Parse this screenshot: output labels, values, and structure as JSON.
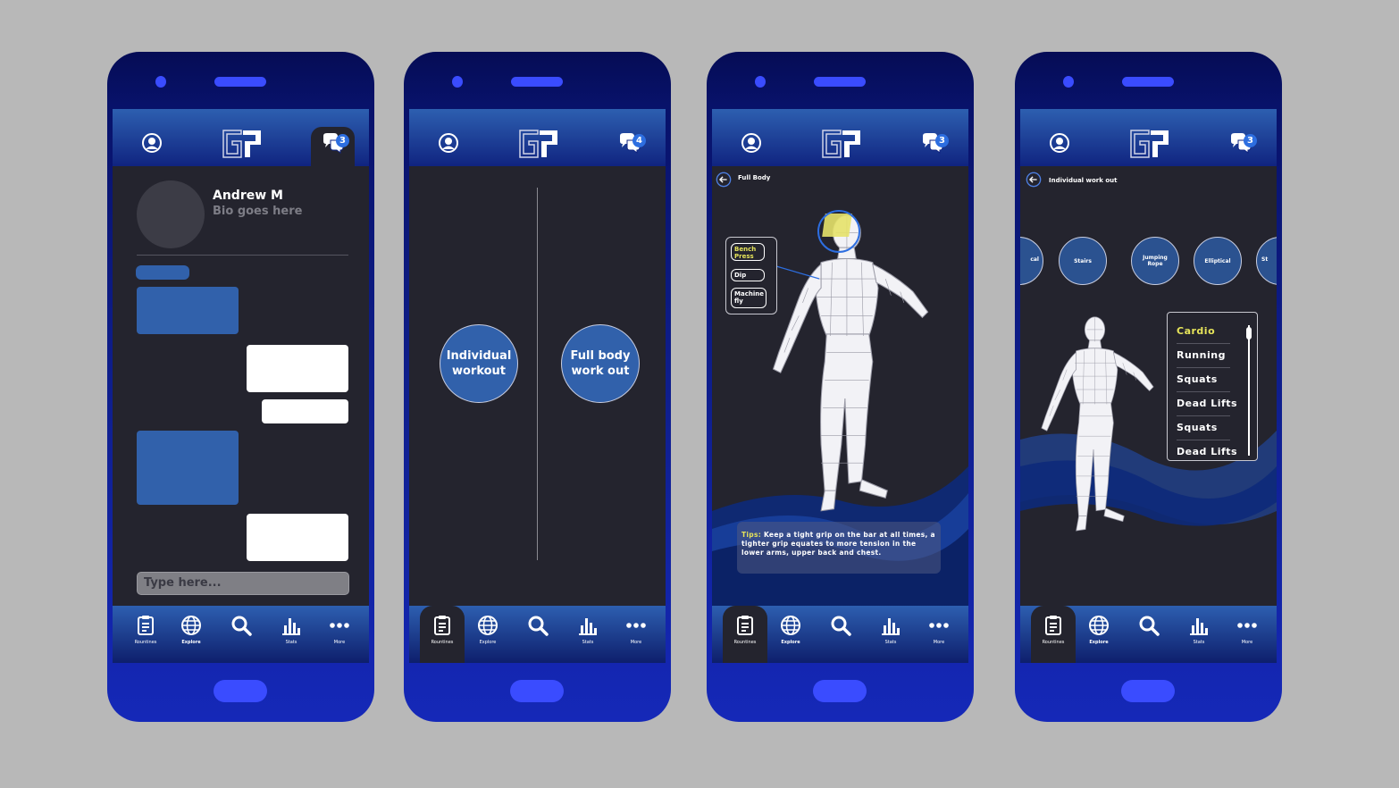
{
  "nav": {
    "routines": "Rountines",
    "explore": "Explore",
    "stats": "Stats",
    "more": "More"
  },
  "phone1": {
    "badge": "3",
    "name": "Andrew M",
    "bio": "Bio goes here",
    "input_placeholder": "Type here..."
  },
  "phone2": {
    "badge": "4",
    "option_individual": "Individual workout",
    "option_fullbody": "Full body work out"
  },
  "phone3": {
    "badge": "3",
    "back_label": "Full Body",
    "exercises": [
      "Bench Press",
      "Dip",
      "Machine fly"
    ],
    "tips_label": "Tips:",
    "tips_text": "Keep a tight grip on the bar at all times, a tighter grip equates to more tension in the lower arms, upper back and chest."
  },
  "phone4": {
    "badge": "3",
    "back_label": "Individual work out",
    "circles": [
      "cal",
      "Stairs",
      "Jumping Rope",
      "Elliptical",
      "St"
    ],
    "menu": [
      "Cardio",
      "Running",
      "Squats",
      "Dead Lifts",
      "Squats",
      "Dead Lifts"
    ]
  },
  "colors": {
    "accent": "#2d5fb0",
    "highlight": "#e5e35a",
    "screen_bg": "#24242e",
    "phone_body": "#0f1f8f",
    "button": "#3a4cff"
  }
}
